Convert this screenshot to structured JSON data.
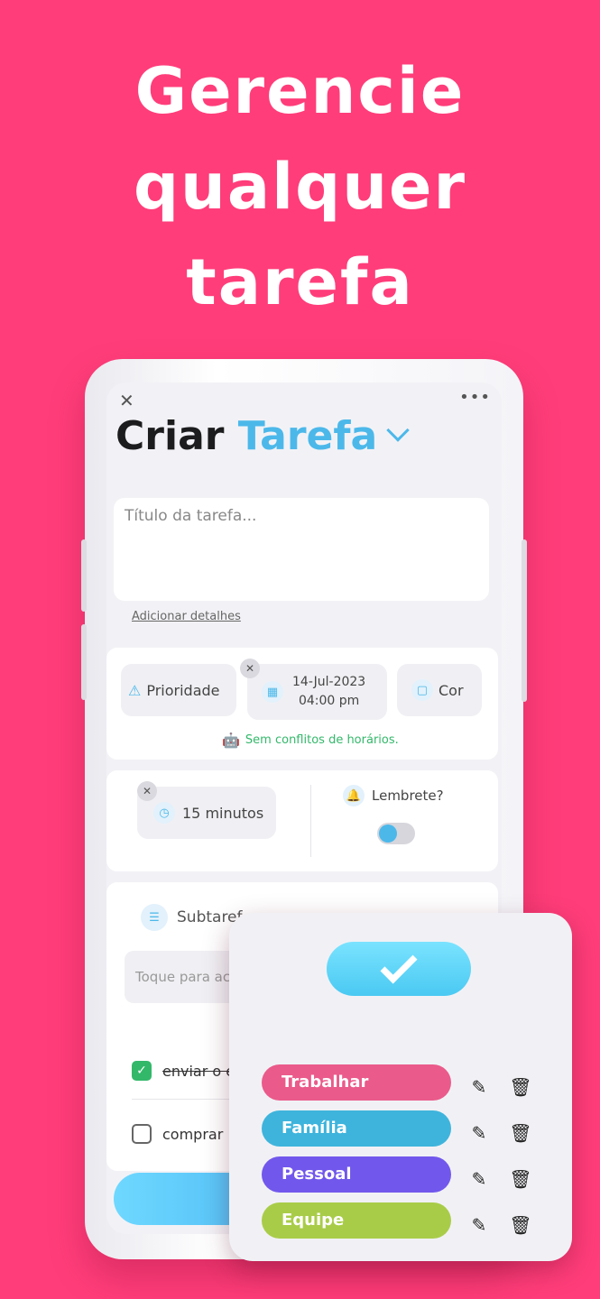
{
  "headline": [
    "Gerencie",
    "qualquer",
    "tarefa"
  ],
  "header": {
    "title_prefix": "Criar",
    "title_accent": "Tarefa"
  },
  "form": {
    "title_placeholder": "Título da tarefa...",
    "add_details": "Adicionar detalhes",
    "priority": "Prioridade",
    "date": "14-Jul-2023",
    "time": "04:00 pm",
    "color": "Cor",
    "conflicts": "Sem conflitos de horários.",
    "duration": "15 minutos",
    "reminder": "Lembrete?",
    "reminder_on": true
  },
  "subtasks": {
    "label": "Subtaref",
    "input_placeholder": "Toque para ac",
    "items": [
      {
        "text": "enviar o e",
        "done": true
      },
      {
        "text": "comprar",
        "done": false
      }
    ]
  },
  "categories": [
    {
      "label": "Trabalhar",
      "color": "#ea5a8a"
    },
    {
      "label": "Família",
      "color": "#3eb4dc"
    },
    {
      "label": "Pessoal",
      "color": "#7257ec"
    },
    {
      "label": "Equipe",
      "color": "#a9cc48"
    }
  ],
  "colors": {
    "background": "#ff3d7a",
    "accent": "#4cb8ea",
    "success": "#33b86a"
  }
}
